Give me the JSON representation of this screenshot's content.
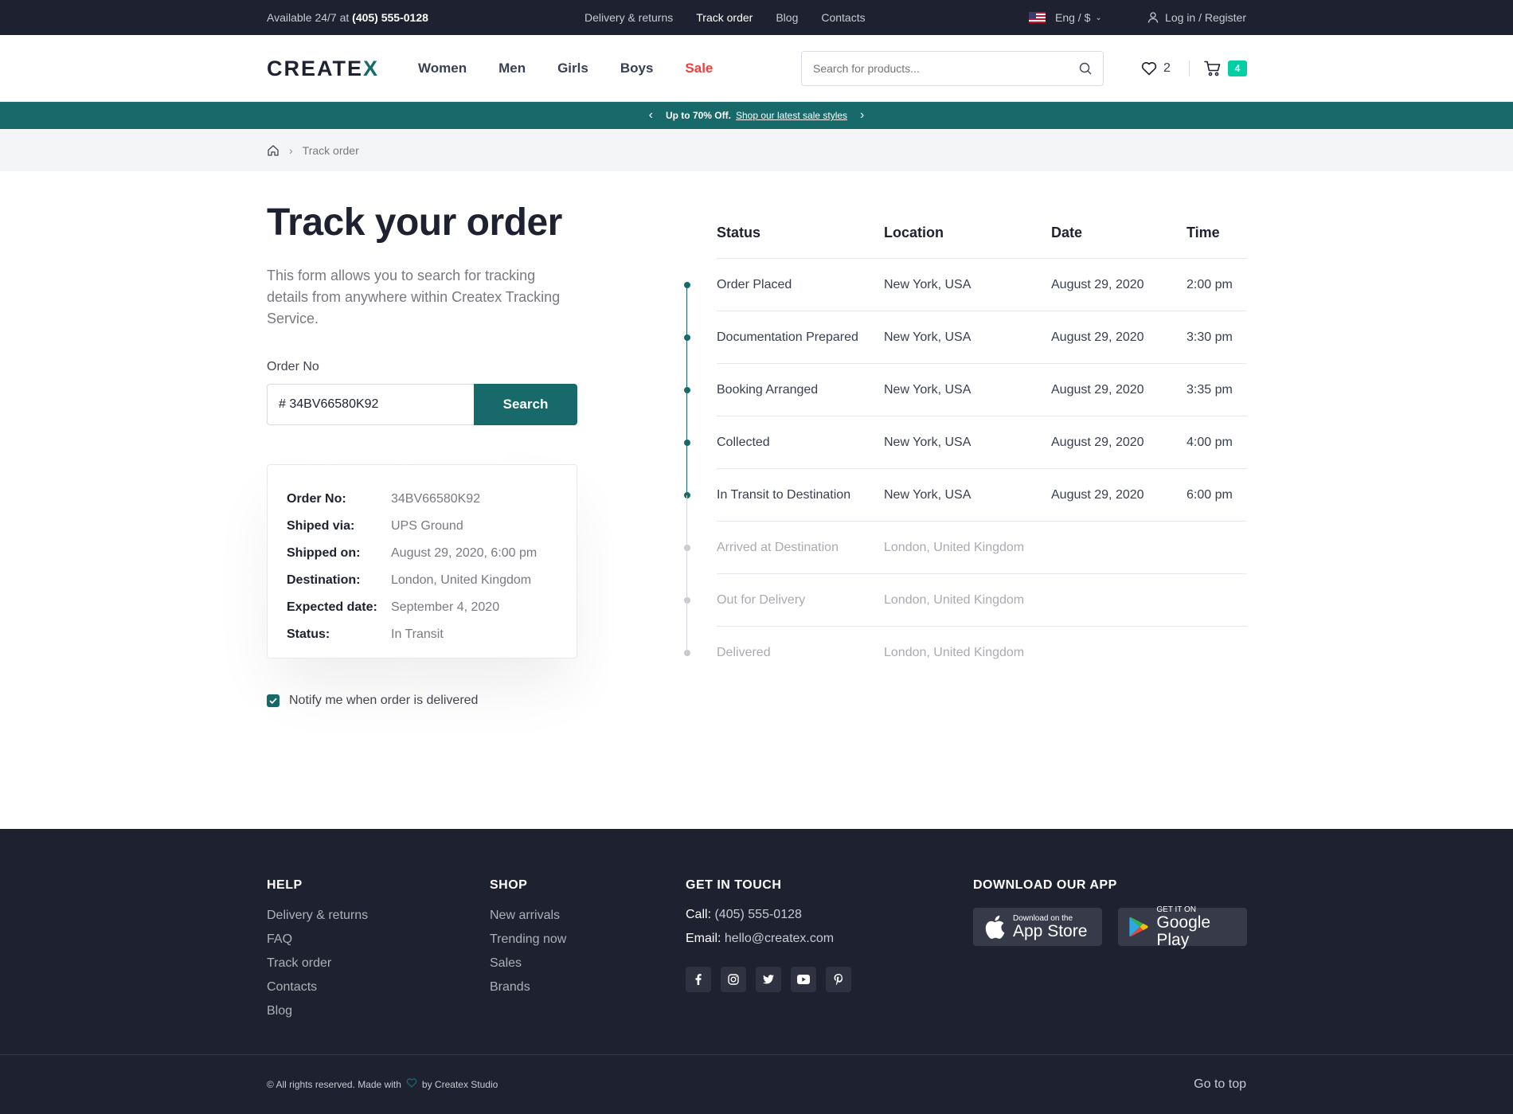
{
  "topbar": {
    "avail_prefix": "Available 24/7 at",
    "phone": "(405) 555-0128",
    "links": [
      "Delivery & returns",
      "Track order",
      "Blog",
      "Contacts"
    ],
    "lang": "Eng / $",
    "login": "Log in / Register"
  },
  "header": {
    "logo_main": "CREATE",
    "logo_x": "X",
    "nav": [
      "Women",
      "Men",
      "Girls",
      "Boys",
      "Sale"
    ],
    "search_placeholder": "Search for products...",
    "wishlist_count": "2",
    "cart_count": "4"
  },
  "promo": {
    "bold": "Up to 70% Off.",
    "link": "Shop our latest sale styles"
  },
  "breadcrumb": {
    "current": "Track order"
  },
  "form": {
    "title": "Track your order",
    "description": "This form allows you to search for tracking details from anywhere within Createx Tracking Service.",
    "order_label": "Order No",
    "order_value": "# 34BV66580K92",
    "search_button": "Search",
    "notify_label": "Notify me when order is delivered"
  },
  "order_info": [
    {
      "key": "Order No:",
      "value": "34BV66580K92"
    },
    {
      "key": "Shiped via:",
      "value": "UPS Ground"
    },
    {
      "key": "Shipped on:",
      "value": "August 29, 2020, 6:00 pm"
    },
    {
      "key": "Destination:",
      "value": "London, United Kingdom"
    },
    {
      "key": "Expected date:",
      "value": "September 4, 2020"
    },
    {
      "key": "Status:",
      "value": "In Transit"
    }
  ],
  "tracking": {
    "headers": [
      "Status",
      "Location",
      "Date",
      "Time"
    ],
    "rows": [
      {
        "status": "Order Placed",
        "location": "New York, USA",
        "date": "August 29, 2020",
        "time": "2:00 pm",
        "done": true
      },
      {
        "status": "Documentation Prepared",
        "location": "New York, USA",
        "date": "August 29, 2020",
        "time": "3:30 pm",
        "done": true
      },
      {
        "status": "Booking Arranged",
        "location": "New York, USA",
        "date": "August 29, 2020",
        "time": "3:35 pm",
        "done": true
      },
      {
        "status": "Collected",
        "location": "New York, USA",
        "date": "August 29, 2020",
        "time": "4:00 pm",
        "done": true
      },
      {
        "status": "In Transit to Destination",
        "location": "New York, USA",
        "date": "August 29, 2020",
        "time": "6:00 pm",
        "done": true
      },
      {
        "status": "Arrived at Destination",
        "location": "London, United Kingdom",
        "date": "",
        "time": "",
        "done": false
      },
      {
        "status": "Out for Delivery",
        "location": "London, United Kingdom",
        "date": "",
        "time": "",
        "done": false
      },
      {
        "status": "Delivered",
        "location": "London, United Kingdom",
        "date": "",
        "time": "",
        "done": false
      }
    ]
  },
  "footer": {
    "help_title": "HELP",
    "help_links": [
      "Delivery & returns",
      "FAQ",
      "Track order",
      "Contacts",
      "Blog"
    ],
    "shop_title": "SHOP",
    "shop_links": [
      "New arrivals",
      "Trending now",
      "Sales",
      "Brands"
    ],
    "touch_title": "GET IN TOUCH",
    "call_label": "Call:",
    "call_value": "(405) 555-0128",
    "email_label": "Email:",
    "email_value": "hello@createx.com",
    "socials": [
      "facebook-icon",
      "instagram-icon",
      "twitter-icon",
      "youtube-icon",
      "pinterest-icon"
    ],
    "app_title": "DOWNLOAD OUR APP",
    "appstore_small": "Download on the",
    "appstore_big": "App Store",
    "gplay_small": "GET IT ON",
    "gplay_big": "Google Play",
    "copyright_a": "© All rights reserved. Made with",
    "copyright_b": "by Createx Studio",
    "go_top": "Go to top"
  },
  "colors": {
    "primary": "#17696a",
    "dark": "#1e2130",
    "sale": "#f03d3d",
    "badge": "#03cea4"
  }
}
